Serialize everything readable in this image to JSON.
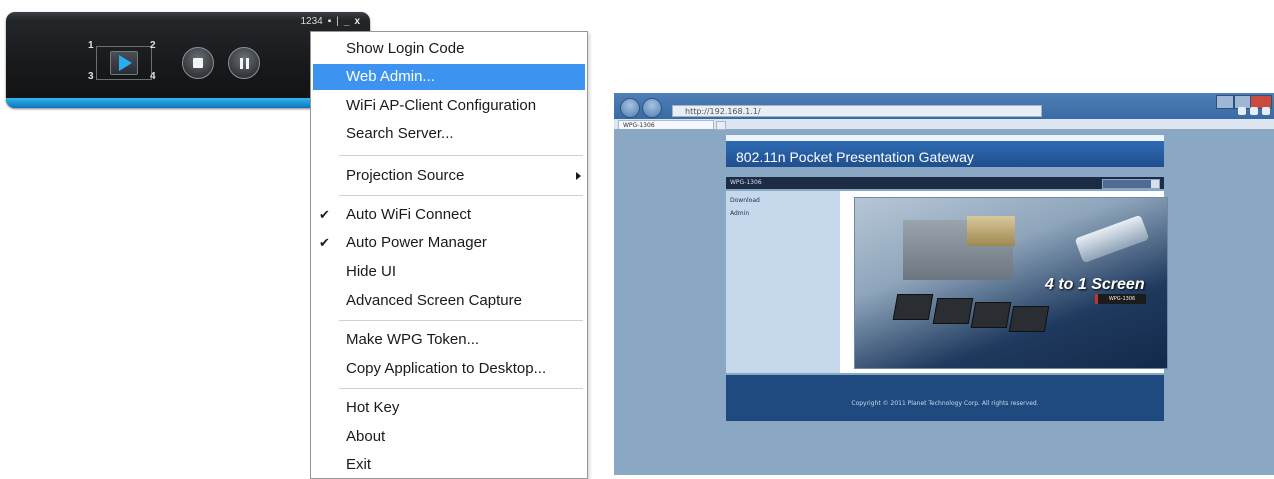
{
  "player": {
    "code": "1234",
    "pin_glyph": "▪",
    "minimize_glyph": "_",
    "close_glyph": "x",
    "separator": "|",
    "quadrants": [
      "1",
      "2",
      "3",
      "4"
    ]
  },
  "menu": {
    "items": [
      {
        "label": "Show Login Code"
      },
      {
        "label": "Web Admin..."
      },
      {
        "label": "WiFi AP-Client Configuration"
      },
      {
        "label": "Search Server..."
      },
      {
        "label": "Projection Source"
      },
      {
        "label": "Auto WiFi Connect"
      },
      {
        "label": "Auto Power Manager"
      },
      {
        "label": "Hide UI"
      },
      {
        "label": "Advanced Screen Capture"
      },
      {
        "label": "Make WPG Token..."
      },
      {
        "label": "Copy Application to Desktop..."
      },
      {
        "label": "Hot Key"
      },
      {
        "label": "About"
      },
      {
        "label": "Exit"
      }
    ],
    "selected": "Web Admin...",
    "checked": [
      "Auto WiFi Connect",
      "Auto Power Manager"
    ],
    "check_glyph": "✔"
  },
  "browser": {
    "address": "http://192.168.1.1/",
    "tab_title": "WPG-1306",
    "zoom": "",
    "page": {
      "header_title": "802.11n Pocket Presentation Gateway",
      "device_name": "WPG-1306",
      "sidebar_links": [
        "Download",
        "Admin"
      ],
      "banner_slogan": "4 to 1 Screen",
      "banner_badge": "WPG-1306",
      "footer": "Copyright © 2011 Planet Technology Corp. All rights reserved."
    }
  },
  "colors": {
    "accent_selection": "#3d94f0",
    "player_glow": "#2fb7f2",
    "page_header": "#2e6bb4"
  }
}
